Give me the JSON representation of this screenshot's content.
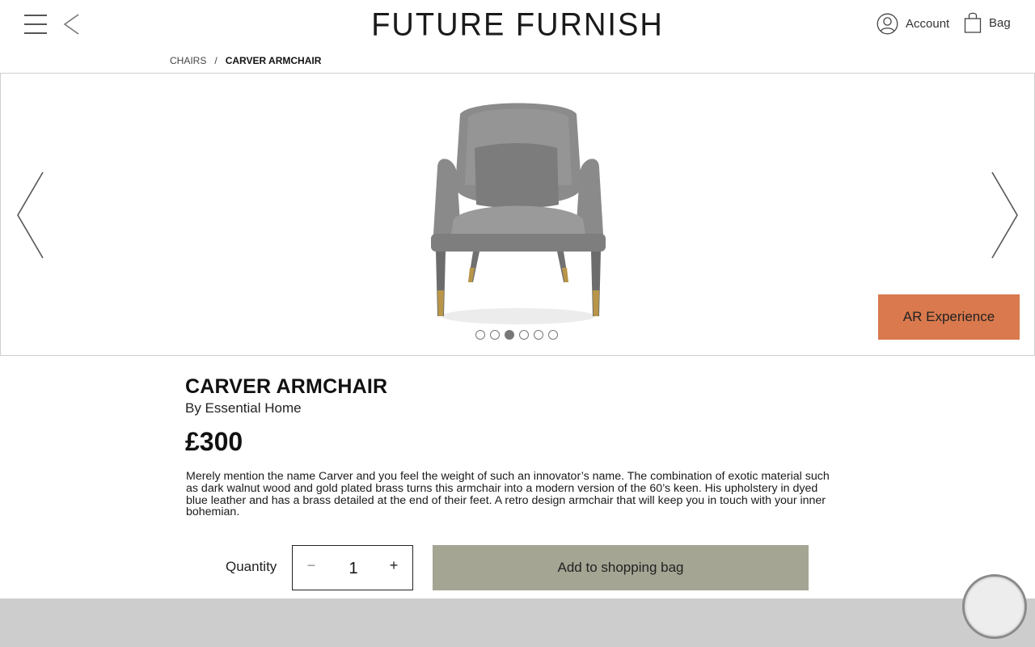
{
  "header": {
    "brand": "FUTURE FURNISH",
    "account_label": "Account",
    "bag_label": "Bag"
  },
  "breadcrumb": {
    "category": "CHAIRS",
    "separator": "/",
    "current": "CARVER ARMCHAIR"
  },
  "gallery": {
    "image_count": 6,
    "active_index": 3,
    "ar_button_label": "AR Experience",
    "ar_color": "#d9794d"
  },
  "product": {
    "title": "CARVER ARMCHAIR",
    "brand_line": "By Essential Home",
    "price": "£300",
    "description": "Merely mention the name Carver and you feel the weight of such an innovator’s name. The combination of exotic material such as dark walnut wood and gold plated brass turns this armchair into a modern version of the 60’s keen. His upholstery in dyed blue leather and has a brass detailed at the end of their feet. A retro design armchair that will keep you in touch with your inner bohemian."
  },
  "purchase": {
    "quantity_label": "Quantity",
    "quantity_value": "1",
    "minus_symbol": "−",
    "plus_symbol": "+",
    "add_label": "Add to shopping bag",
    "add_color": "#a5a594"
  },
  "icons": {
    "menu": "menu-icon",
    "back": "chevron-left-icon",
    "account": "user-icon",
    "bag": "shopping-bag-icon",
    "prev": "chevron-left-icon",
    "next": "chevron-right-icon",
    "chat": "chat-icon"
  }
}
